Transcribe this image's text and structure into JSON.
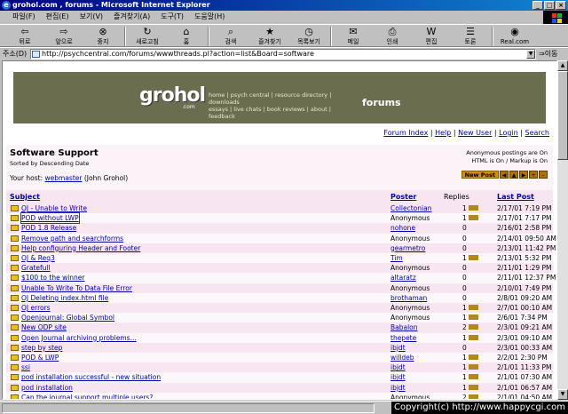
{
  "window": {
    "title": "grohol.com , forums - Microsoft Internet Explorer"
  },
  "menu": [
    "파일(F)",
    "편집(E)",
    "보기(V)",
    "즐겨찾기(A)",
    "도구(T)",
    "도움말(H)"
  ],
  "toolbar": [
    {
      "label": "뒤로",
      "icon": "back-arrow-icon",
      "glyph": "⇦"
    },
    {
      "label": "앞으로",
      "icon": "forward-arrow-icon",
      "glyph": "⇨"
    },
    {
      "label": "중지",
      "icon": "stop-icon",
      "glyph": "⊗"
    },
    {
      "label": "새로고침",
      "icon": "refresh-icon",
      "glyph": "↻"
    },
    {
      "label": "홈",
      "icon": "home-icon",
      "glyph": "⌂"
    },
    {
      "label": "검색",
      "icon": "search-icon",
      "glyph": "⌕"
    },
    {
      "label": "즐겨찾기",
      "icon": "favorites-icon",
      "glyph": "★"
    },
    {
      "label": "목록보기",
      "icon": "history-icon",
      "glyph": "◷"
    },
    {
      "label": "메일",
      "icon": "mail-icon",
      "glyph": "✉"
    },
    {
      "label": "인쇄",
      "icon": "print-icon",
      "glyph": "⎙"
    },
    {
      "label": "편집",
      "icon": "edit-icon",
      "glyph": "W"
    },
    {
      "label": "토론",
      "icon": "discuss-icon",
      "glyph": "☰"
    },
    {
      "label": "Real.com",
      "icon": "real-icon",
      "glyph": "◉"
    }
  ],
  "address": {
    "label": "주소(D)",
    "url": "http://psychcentral.com/forums/wwwthreads.pl?action=list&Board=software",
    "go": "이동"
  },
  "banner": {
    "logo": "grohol",
    "logo_suffix": ".com",
    "links_line1": "home | psych central | resource directory | downloads",
    "links_line2": "essays | live chats | book reviews | about | feedback",
    "section": "forums"
  },
  "nav": [
    "Forum Index",
    "Help",
    "New User",
    "Login",
    "Search"
  ],
  "board": {
    "title": "Software Support",
    "sort": "Sorted by Descending Date",
    "host_prefix": "Your host:",
    "host_link": "webmaster",
    "host_suffix": "(John Grohol)",
    "note1": "Anonymous postings are On",
    "note2": "HTML is On / Markup is On",
    "new_post": "New Post"
  },
  "columns": {
    "subject": "Subject",
    "poster": "Poster",
    "replies": "Replies",
    "last_post": "Last Post"
  },
  "threads": [
    {
      "subject": "OJ - Unable to Write",
      "poster": "Collectonian",
      "poster_link": true,
      "replies": "1",
      "new": true,
      "last": "2/17/01 7:19 PM"
    },
    {
      "subject": "POD without LWP",
      "poster": "Anonymous",
      "poster_link": false,
      "replies": "1",
      "new": true,
      "last": "2/17/01 7:17 PM",
      "boxed": true
    },
    {
      "subject": "POD 1.8 Release",
      "poster": "nohone",
      "poster_link": true,
      "replies": "0",
      "new": false,
      "last": "2/16/01 2:58 PM"
    },
    {
      "subject": "Remove path and searchforms",
      "poster": "Anonymous",
      "poster_link": false,
      "replies": "0",
      "new": false,
      "last": "2/14/01 09:50 AM"
    },
    {
      "subject": "Help configuring Header and Footer",
      "poster": "gearmetro",
      "poster_link": true,
      "replies": "0",
      "new": false,
      "last": "2/13/01 11:42 PM"
    },
    {
      "subject": "OJ & Req3",
      "poster": "Tim",
      "poster_link": true,
      "replies": "1",
      "new": true,
      "last": "2/13/01 5:32 PM"
    },
    {
      "subject": "Gratefull",
      "poster": "Anonymous",
      "poster_link": false,
      "replies": "0",
      "new": false,
      "last": "2/11/01 1:29 PM"
    },
    {
      "subject": "$100 to the winner",
      "poster": "altaratz",
      "poster_link": true,
      "replies": "0",
      "new": false,
      "last": "2/11/01 12:37 PM"
    },
    {
      "subject": "Unable To Write To Data File Error",
      "poster": "Anonymous",
      "poster_link": false,
      "replies": "0",
      "new": false,
      "last": "2/10/01 7:49 PM"
    },
    {
      "subject": "OJ Deleting index.html file",
      "poster": "brothaman",
      "poster_link": true,
      "replies": "0",
      "new": false,
      "last": "2/8/01 09:20 AM"
    },
    {
      "subject": "OJ errors",
      "poster": "Anonymous",
      "poster_link": false,
      "replies": "1",
      "new": true,
      "last": "2/7/01 00:10 AM"
    },
    {
      "subject": "Openjournal: Global Symbol",
      "poster": "Anonymous",
      "poster_link": false,
      "replies": "1",
      "new": true,
      "last": "2/6/01 7:34 PM"
    },
    {
      "subject": "New ODP site",
      "poster": "Babalon",
      "poster_link": true,
      "replies": "2",
      "new": true,
      "last": "2/3/01 09:21 AM"
    },
    {
      "subject": "Open Journal archiving problems...",
      "poster": "thepete",
      "poster_link": true,
      "replies": "1",
      "new": true,
      "last": "2/3/01 09:10 AM"
    },
    {
      "subject": "step by step",
      "poster": "ibjdt",
      "poster_link": true,
      "replies": "0",
      "new": false,
      "last": "2/3/01 00:33 AM"
    },
    {
      "subject": "POD & LWP",
      "poster": "willdeb",
      "poster_link": true,
      "replies": "1",
      "new": true,
      "last": "2/2/01 2:30 PM"
    },
    {
      "subject": "ssi",
      "poster": "ibjdt",
      "poster_link": true,
      "replies": "1",
      "new": true,
      "last": "2/1/01 11:33 PM"
    },
    {
      "subject": "pod installation successful - new situation",
      "poster": "ibjdt",
      "poster_link": true,
      "replies": "1",
      "new": true,
      "last": "2/1/01 07:30 AM"
    },
    {
      "subject": "pod installation",
      "poster": "ibjdt",
      "poster_link": true,
      "replies": "1",
      "new": true,
      "last": "2/1/01 06:57 AM"
    },
    {
      "subject": "Can the journal support multiple users?",
      "poster": "Anonymous",
      "poster_link": false,
      "replies": "2",
      "new": true,
      "last": "2/1/01 04:50 AM"
    }
  ],
  "copyright": "Copyright(c) http://www.happycgi.com"
}
